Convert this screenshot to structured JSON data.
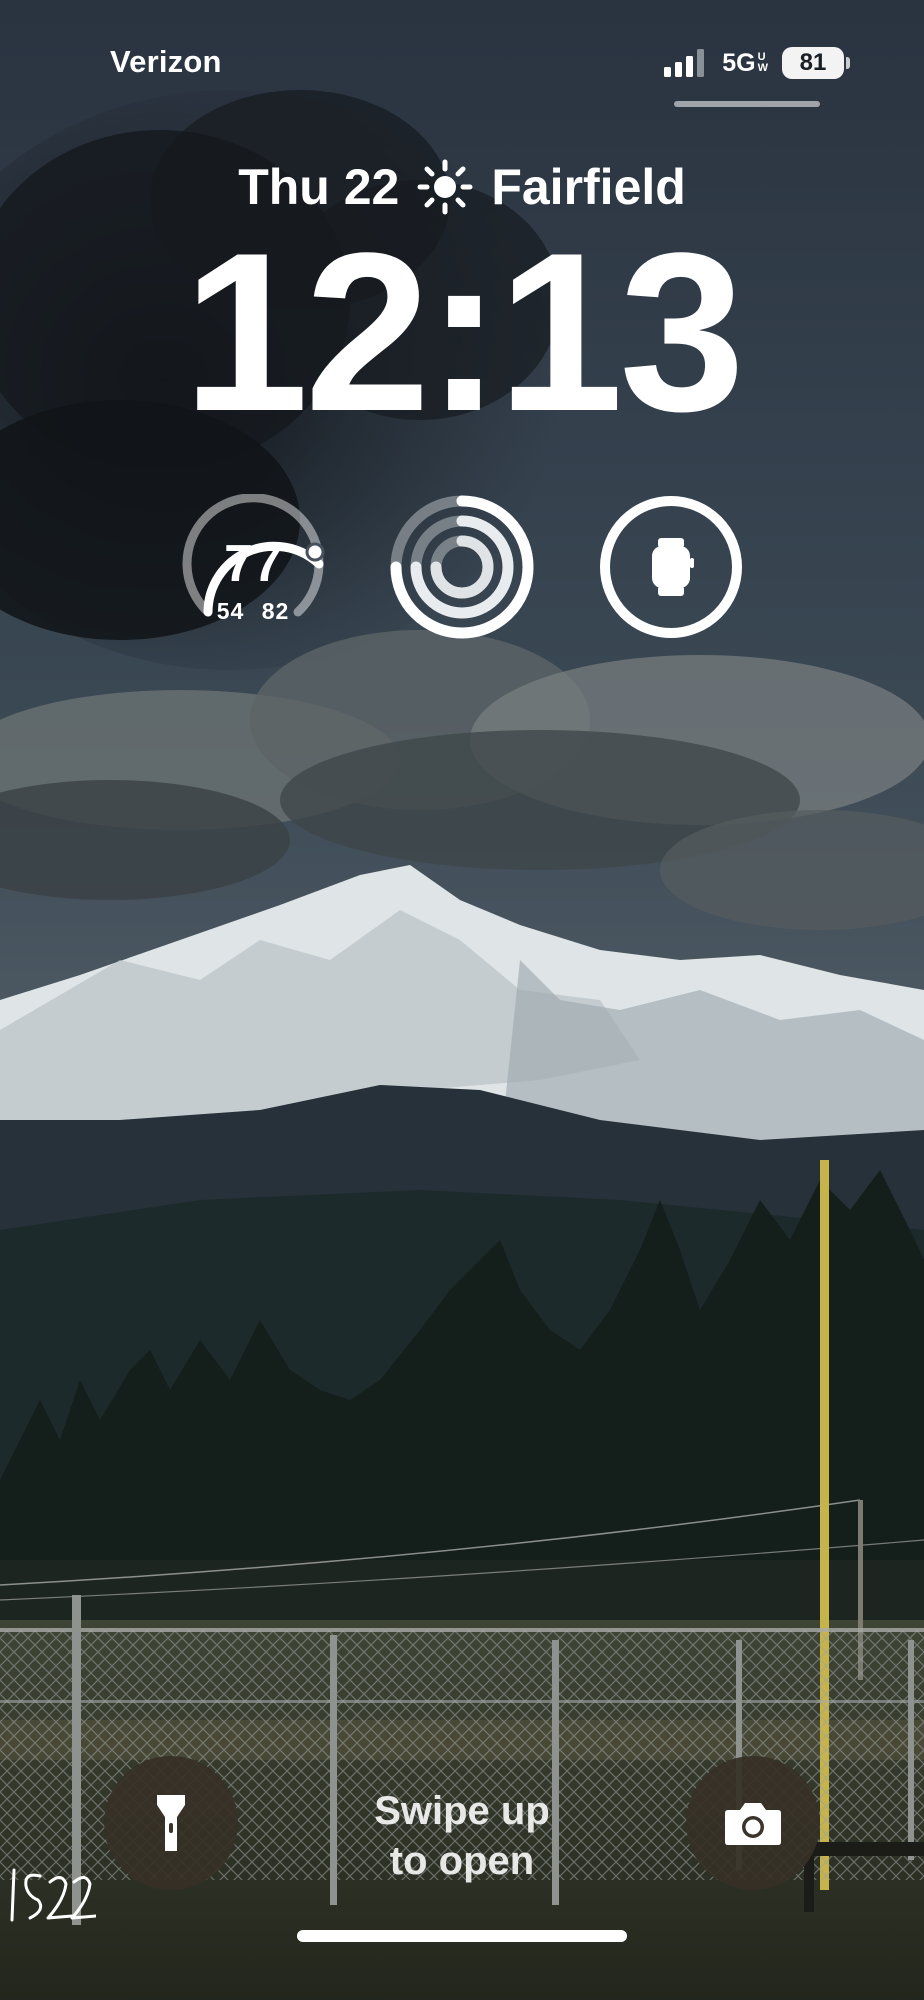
{
  "status_bar": {
    "carrier": "Verizon",
    "network": "5G",
    "network_suffix_top": "U",
    "network_suffix_bottom": "W",
    "battery_percent": "81",
    "signal_bars": 4
  },
  "lock_screen": {
    "date": "Thu 22",
    "weather_icon": "sun-icon",
    "location": "Fairfield",
    "time": "12:13"
  },
  "widgets": {
    "weather": {
      "current_temp": "77",
      "low": "54",
      "high": "82"
    },
    "activity": {
      "icon": "activity-rings-icon"
    },
    "watch": {
      "icon": "apple-watch-icon"
    }
  },
  "bottom": {
    "swipe_line1": "Swipe up",
    "swipe_line2": "to open",
    "flashlight_icon": "flashlight-icon",
    "camera_icon": "camera-icon"
  },
  "wallpaper": {
    "signature_text": "IS22"
  }
}
